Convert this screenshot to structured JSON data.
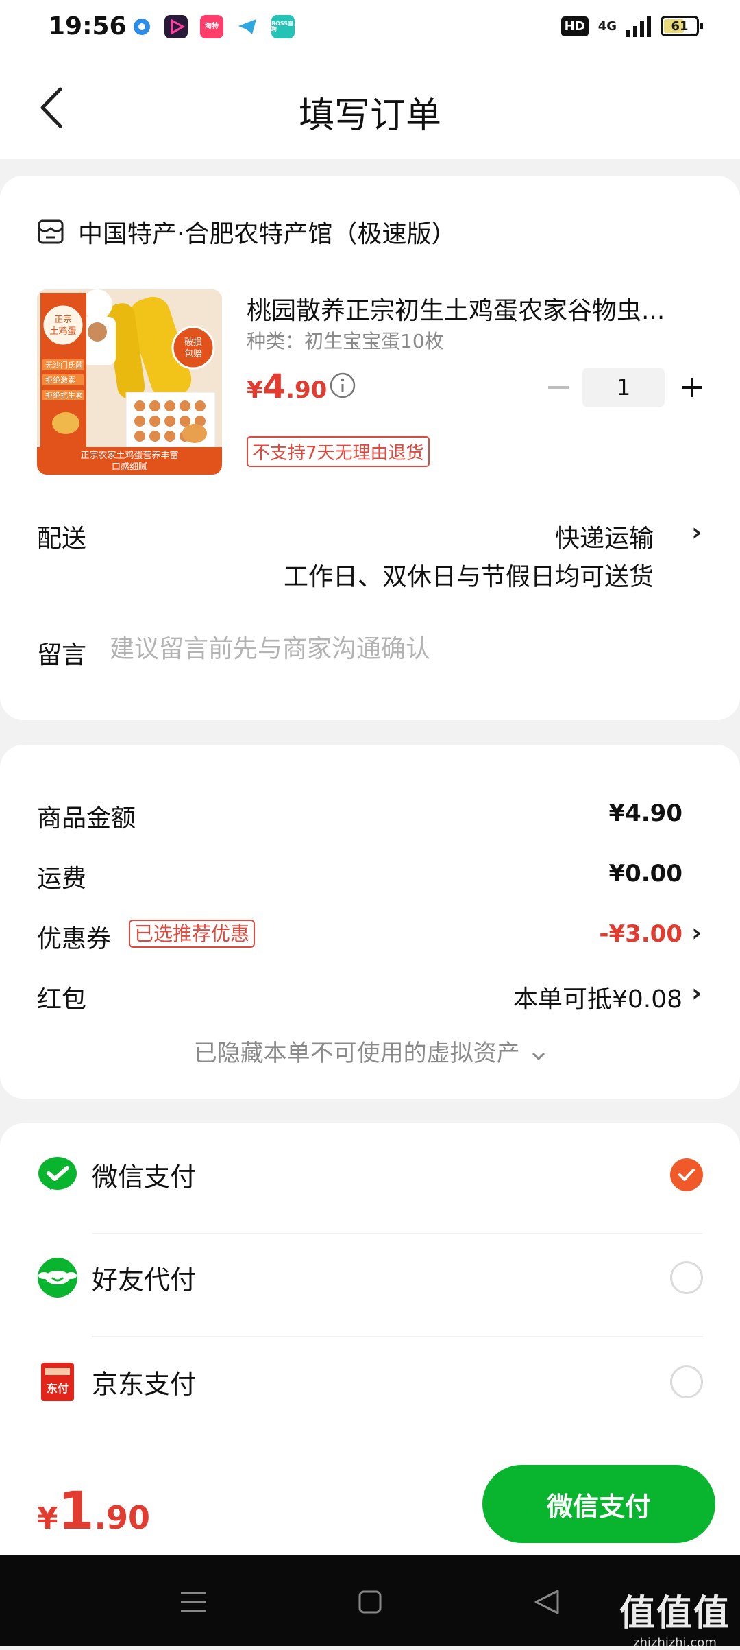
{
  "status_bar": {
    "time": "19:56",
    "hd_label": "HD",
    "network_label": "4G",
    "battery_percent": "61",
    "app_icons": [
      "circle-app-icon",
      "video-app-icon",
      "taote-app-icon",
      "telegram-app-icon",
      "boss-app-icon"
    ],
    "app_icon_texts": [
      "",
      "",
      "淘特",
      "",
      "BOSS直聘"
    ]
  },
  "header": {
    "title": "填写订单"
  },
  "order": {
    "shop_name": "中国特产·合肥农特产馆（极速版）",
    "product": {
      "title": "桃园散养正宗初生土鸡蛋农家谷物虫...",
      "spec": "种类：初生宝宝蛋10枚",
      "price_symbol": "¥",
      "price_int": "4",
      "price_dec": ".90",
      "quantity": "1",
      "return_tag": "不支持7天无理由退货",
      "image_texts": {
        "badge_top": "正宗\n土鸡蛋",
        "badge_right": "破损\n包赔",
        "bullets": [
          "无沙门氏菌",
          "拒绝激素",
          "拒绝抗生素"
        ],
        "banner": "正宗农家土鸡蛋营养丰富口感细腻"
      }
    },
    "delivery": {
      "label": "配送",
      "method": "快递运输",
      "note": "工作日、双休日与节假日均可送货"
    },
    "message": {
      "label": "留言",
      "placeholder": "建议留言前先与商家沟通确认",
      "value": ""
    }
  },
  "price_summary": {
    "goods_label": "商品金额",
    "goods_value": "¥4.90",
    "shipping_label": "运费",
    "shipping_value": "¥0.00",
    "coupon_label": "优惠券",
    "coupon_tag": "已选推荐优惠",
    "coupon_value": "-¥3.00",
    "redpacket_label": "红包",
    "redpacket_value": "本单可抵¥0.08",
    "hidden_assets": "已隐藏本单不可使用的虚拟资产",
    "colors": {
      "discount": "#e23b2f"
    }
  },
  "payment": {
    "methods": [
      {
        "label": "微信支付",
        "icon": "wechat-pay-icon",
        "selected": true
      },
      {
        "label": "好友代付",
        "icon": "friend-pay-icon",
        "selected": false
      },
      {
        "label": "京东支付",
        "icon": "jd-pay-icon",
        "icon_text": "东付",
        "selected": false
      }
    ],
    "colors": {
      "selected": "#f05a2b",
      "wechat_green": "#09b52f"
    }
  },
  "footer": {
    "total_symbol": "¥",
    "total_int": "1",
    "total_dec": ".90",
    "pay_button_label": "微信支付"
  },
  "watermark": {
    "cn": "值值值",
    "en": "zhizhizhi.com"
  }
}
